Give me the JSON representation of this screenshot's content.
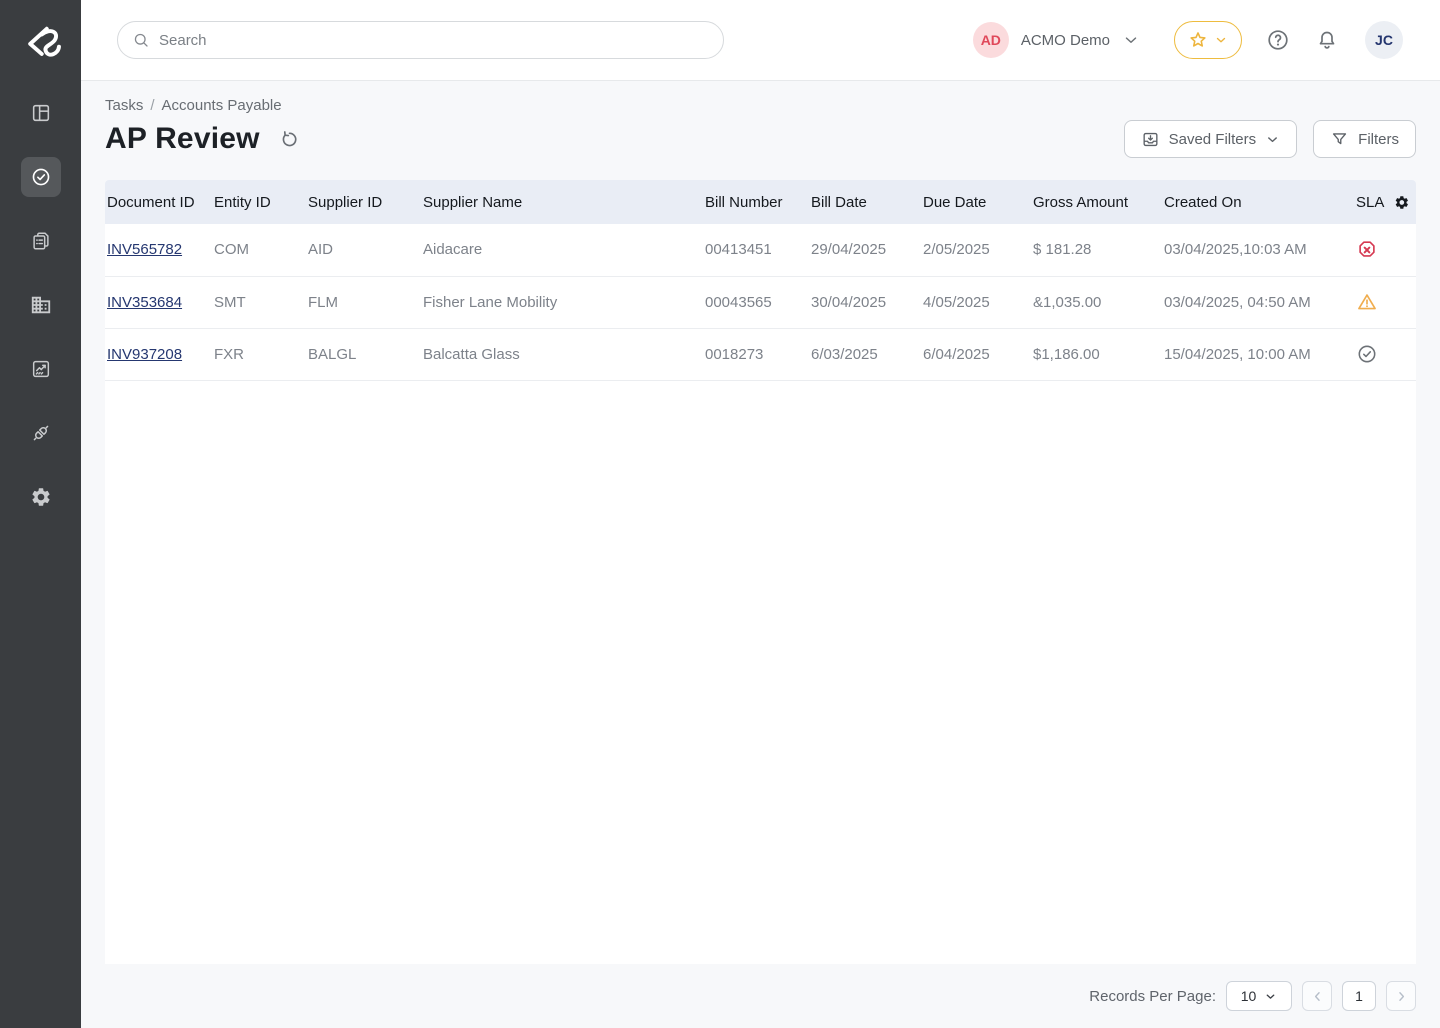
{
  "sidebar": {
    "items": [
      {
        "id": "dashboard",
        "active": false
      },
      {
        "id": "tasks",
        "active": true
      },
      {
        "id": "documents",
        "active": false
      },
      {
        "id": "organization",
        "active": false
      },
      {
        "id": "analytics",
        "active": false
      },
      {
        "id": "integrations",
        "active": false
      },
      {
        "id": "settings",
        "active": false
      }
    ]
  },
  "topbar": {
    "search_placeholder": "Search",
    "account_initials": "AD",
    "account_name": "ACMO Demo",
    "user_initials": "JC"
  },
  "breadcrumb": {
    "parent": "Tasks",
    "separator": "/",
    "current": "Accounts Payable"
  },
  "page": {
    "title": "AP Review"
  },
  "toolbar": {
    "saved_filters": "Saved Filters",
    "filters": "Filters"
  },
  "table": {
    "columns": [
      "Document ID",
      "Entity ID",
      "Supplier ID",
      "Supplier Name",
      "Bill Number",
      "Bill Date",
      "Due Date",
      "Gross Amount",
      "Created On",
      "SLA"
    ],
    "rows": [
      {
        "document_id": "INV565782",
        "entity_id": "COM",
        "supplier_id": "AID",
        "supplier_name": "Aidacare",
        "bill_number": "00413451",
        "bill_date": "29/04/2025",
        "due_date": "2/05/2025",
        "gross_amount": "$ 181.28",
        "created_on": "03/04/2025,10:03 AM",
        "sla": "breached"
      },
      {
        "document_id": "INV353684",
        "entity_id": "SMT",
        "supplier_id": "FLM",
        "supplier_name": "Fisher Lane Mobility",
        "bill_number": "00043565",
        "bill_date": "30/04/2025",
        "due_date": "4/05/2025",
        "gross_amount": "&1,035.00",
        "created_on": "03/04/2025, 04:50 AM",
        "sla": "warning"
      },
      {
        "document_id": "INV937208",
        "entity_id": "FXR",
        "supplier_id": "BALGL",
        "supplier_name": "Balcatta Glass",
        "bill_number": "0018273",
        "bill_date": "6/03/2025",
        "due_date": "6/04/2025",
        "gross_amount": "$1,186.00",
        "created_on": "15/04/2025, 10:00 AM",
        "sla": "met"
      }
    ]
  },
  "pagination": {
    "label": "Records Per Page:",
    "per_page": "10",
    "page": "1"
  },
  "colors": {
    "accent_gold": "#edb53e",
    "sla_breached": "#d63a52",
    "sla_warning": "#f0ad4e",
    "sla_met": "#6d7277",
    "link_navy": "#253770",
    "sidebar_bg": "#3a3d40",
    "table_header_bg": "#e9edf5"
  }
}
